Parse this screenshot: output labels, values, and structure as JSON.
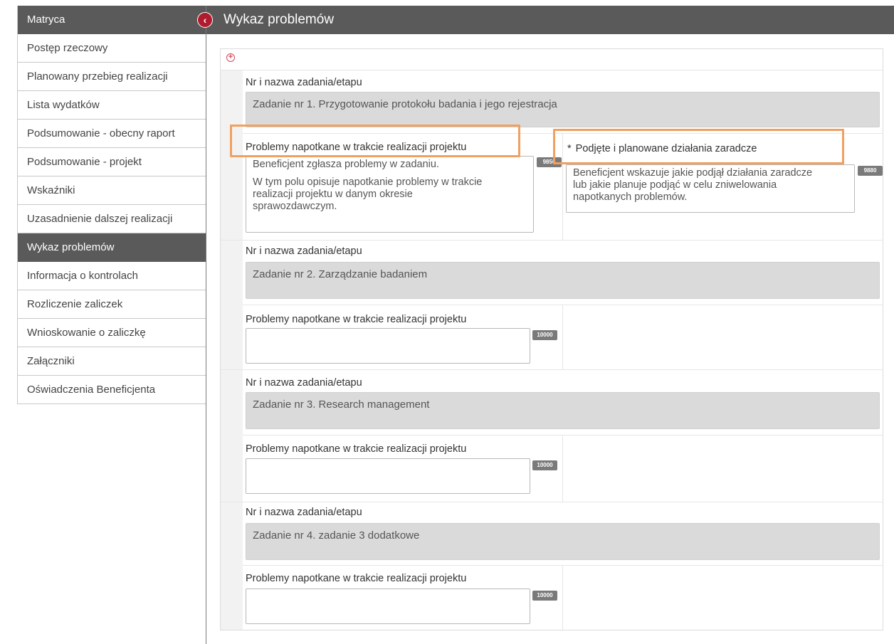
{
  "sidebar": {
    "header": "Matryca",
    "items": [
      {
        "label": "Postęp rzeczowy"
      },
      {
        "label": "Planowany przebieg realizacji"
      },
      {
        "label": "Lista wydatków"
      },
      {
        "label": "Podsumowanie - obecny raport"
      },
      {
        "label": "Podsumowanie - projekt"
      },
      {
        "label": "Wskaźniki"
      },
      {
        "label": "Uzasadnienie dalszej realizacji"
      },
      {
        "label": "Wykaz problemów"
      },
      {
        "label": "Informacja o kontrolach"
      },
      {
        "label": "Rozliczenie zaliczek"
      },
      {
        "label": "Wnioskowanie o zaliczkę"
      },
      {
        "label": "Załączniki"
      },
      {
        "label": "Oświadczenia Beneficjenta"
      }
    ],
    "active_index": 7,
    "collapse_icon": "chevron-left-icon"
  },
  "header": {
    "title": "Wykaz problemów"
  },
  "toolbar": {
    "add_icon": "plus-circle-icon"
  },
  "labels": {
    "task_label": "Nr i nazwa zadania/etapu",
    "problems_label": "Problemy napotkane w trakcie realizacji projektu",
    "remedial_label": "Podjęte i planowane działania zaradcze",
    "required_mark": "*"
  },
  "tasks": [
    {
      "name": "Zadanie nr 1. Przygotowanie protokołu badania i jego rejestracja",
      "problems_text_1": "Beneficjent zgłasza problemy w zadaniu.",
      "problems_text_2": "W tym polu opisuje napotkanie problemy w trakcie",
      "problems_text_3": "realizacji projektu w danym okresie",
      "problems_text_4": "sprawozdawczym.",
      "problems_counter": "9850",
      "remedial_text_1": "Beneficjent wskazuje jakie podjął działania zaradcze",
      "remedial_text_2": "lub jakie planuje podjąć w celu zniwelowania",
      "remedial_text_3": "napotkanych problemów.",
      "remedial_counter": "9880"
    },
    {
      "name": "Zadanie nr 2. Zarządzanie badaniem",
      "problems_counter": "10000"
    },
    {
      "name": "Zadanie nr 3. Research management",
      "problems_counter": "10000"
    },
    {
      "name": "Zadanie nr 4. zadanie 3 dodatkowe",
      "problems_counter": "10000"
    }
  ],
  "colors": {
    "header_bg": "#5a5a5a",
    "accent_red": "#b01c2e",
    "highlight": "#f0a060",
    "readonly_bg": "#dadada"
  }
}
